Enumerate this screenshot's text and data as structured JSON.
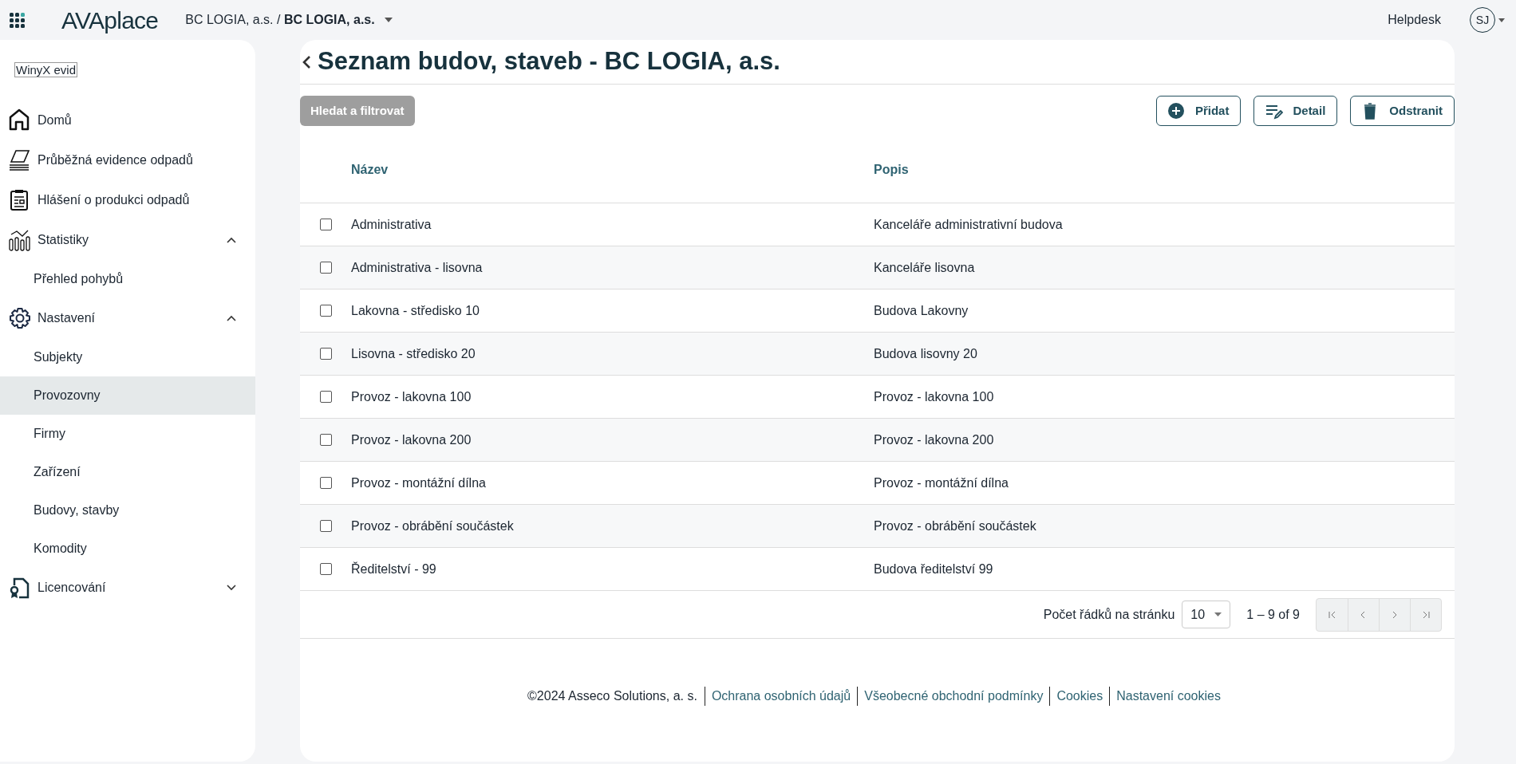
{
  "topbar": {
    "logo": "**AVA**place",
    "breadcrumb": "BC LOGIA, a.s. / **BC LOGIA, a.s.**",
    "helpdesk": "Helpdesk",
    "avatar": "SJ"
  },
  "sidebar": {
    "app_label": "WinyX evid",
    "items": [
      {
        "label": "Domů",
        "kind": "home",
        "selected": false
      },
      {
        "label": "Průběžná evidence odpadů",
        "kind": "papers",
        "selected": false
      },
      {
        "label": "Hlášení o produkci odpadů",
        "kind": "clipboard",
        "selected": false
      },
      {
        "label": "Statistiky",
        "kind": "chart",
        "selected": false,
        "expanded": true,
        "children": [
          {
            "label": "Přehled pohybů",
            "selected": false
          }
        ]
      },
      {
        "label": "Nastavení",
        "kind": "gear",
        "selected": false,
        "expanded": true,
        "children": [
          {
            "label": "Subjekty",
            "selected": false
          },
          {
            "label": "Provozovny",
            "selected": true
          },
          {
            "label": "Firmy",
            "selected": false
          },
          {
            "label": "Zařízení",
            "selected": false
          },
          {
            "label": "Budovy, stavby",
            "selected": false
          },
          {
            "label": "Komodity",
            "selected": false
          }
        ]
      },
      {
        "label": "Licencování",
        "kind": "license",
        "selected": false,
        "expanded": false
      }
    ]
  },
  "page": {
    "title": "Seznam budov, staveb - BC LOGIA, a.s.",
    "filter_button": {
      "label": "Hledat a filtrovat",
      "disabled": true
    },
    "actions": [
      {
        "label": "Přidat",
        "kind": "plus"
      },
      {
        "label": "Detail",
        "kind": "edit"
      },
      {
        "label": "Odstranit",
        "kind": "trash"
      }
    ]
  },
  "table": {
    "columns": [
      "Název",
      "Popis"
    ],
    "rows": [
      {
        "cells": [
          "Administrativa",
          "Kanceláře administrativní budova"
        ],
        "checked": false
      },
      {
        "cells": [
          "Administrativa - lisovna",
          "Kanceláře lisovna"
        ],
        "checked": false
      },
      {
        "cells": [
          "Lakovna - středisko 10",
          "Budova Lakovny"
        ],
        "checked": false
      },
      {
        "cells": [
          "Lisovna - středisko 20",
          "Budova lisovny 20"
        ],
        "checked": false
      },
      {
        "cells": [
          "Provoz - lakovna 100",
          "Provoz - lakovna 100"
        ],
        "checked": false
      },
      {
        "cells": [
          "Provoz - lakovna 200",
          "Provoz - lakovna 200"
        ],
        "checked": false
      },
      {
        "cells": [
          "Provoz - montážní dílna",
          "Provoz - montážní dílna"
        ],
        "checked": false
      },
      {
        "cells": [
          "Provoz - obrábění součástek",
          "Provoz - obrábění součástek"
        ],
        "checked": false
      },
      {
        "cells": [
          "Ředitelství - 99",
          "Budova ředitelství 99"
        ],
        "checked": false
      }
    ]
  },
  "pagination": {
    "rows_per_page_label": "Počet řádků na stránku",
    "rows_per_page": "10",
    "range": "1 – 9 of 9"
  },
  "footer": {
    "copyright": "©2024 Asseco Solutions, a. s.",
    "links": [
      "Ochrana osobních údajů",
      "Všeobecné obchodní podmínky",
      "Cookies",
      "Nastavení cookies"
    ]
  }
}
